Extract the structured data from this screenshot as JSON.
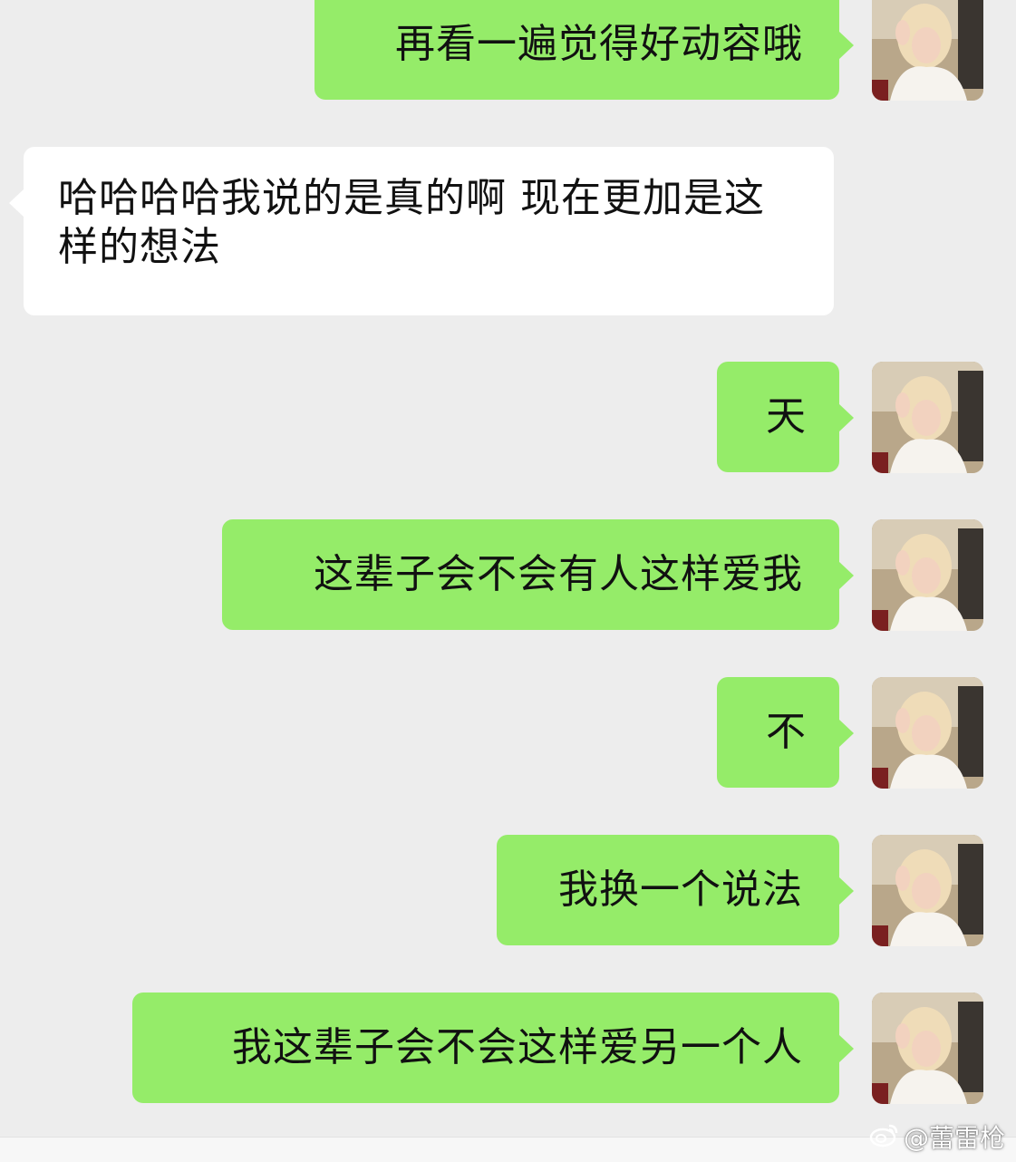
{
  "colors": {
    "background": "#ededed",
    "sent_bubble": "#95ec69",
    "received_bubble": "#ffffff",
    "text": "#111111"
  },
  "messages": [
    {
      "sender": "me",
      "text": "再看一遍觉得好动容哦"
    },
    {
      "sender": "them",
      "text": "哈哈哈哈我说的是真的啊 现在更加是这样的想法"
    },
    {
      "sender": "me",
      "text": "天"
    },
    {
      "sender": "me",
      "text": "这辈子会不会有人这样爱我"
    },
    {
      "sender": "me",
      "text": "不"
    },
    {
      "sender": "me",
      "text": "我换一个说法"
    },
    {
      "sender": "me",
      "text": "我这辈子会不会这样爱另一个人"
    }
  ],
  "watermark": {
    "icon": "weibo-icon",
    "text": "@蕾雷枪"
  }
}
